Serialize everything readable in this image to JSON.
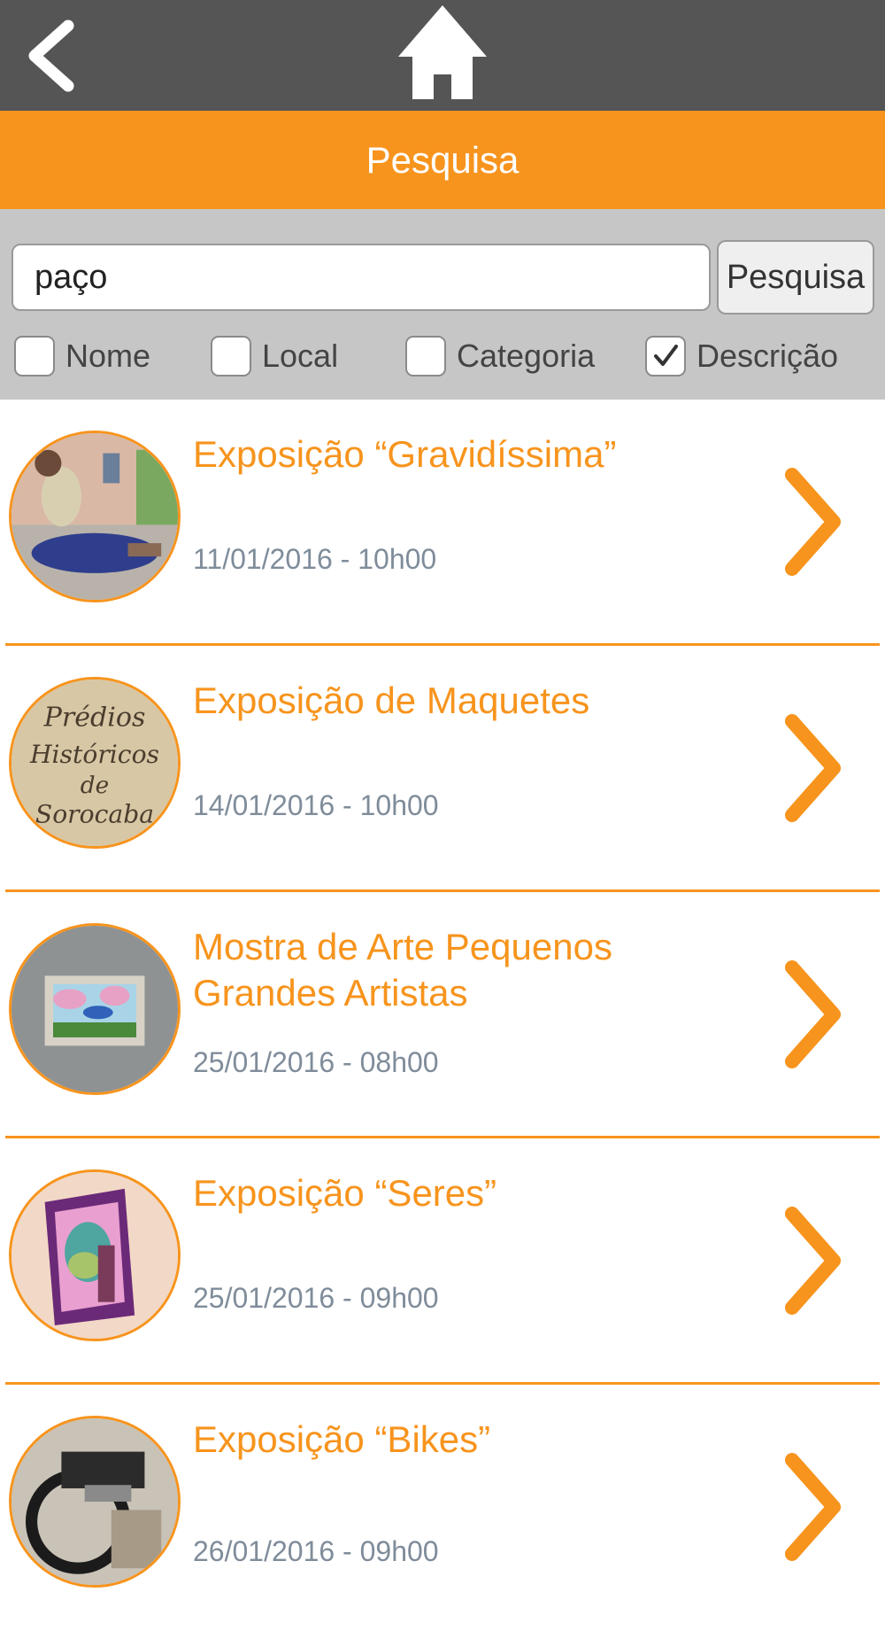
{
  "header": {
    "back_icon": "chevron-left-icon",
    "home_icon": "home-icon"
  },
  "title": "Pesquisa",
  "search": {
    "value": "paço",
    "button_label": "Pesquisa"
  },
  "filters": [
    {
      "label": "Nome",
      "checked": false
    },
    {
      "label": "Local",
      "checked": false
    },
    {
      "label": "Categoria",
      "checked": false
    },
    {
      "label": "Descrição",
      "checked": true
    }
  ],
  "colors": {
    "accent": "#F7941D",
    "header_bg": "#555555",
    "panel_bg": "#C6C6C6",
    "date_text": "#7F8C9A"
  },
  "results": [
    {
      "title": "Exposição “Gravidíssima”",
      "date": "11/01/2016 - 10h00"
    },
    {
      "title": "Exposição de Maquetes",
      "date": "14/01/2016 - 10h00"
    },
    {
      "title": "Mostra de Arte Pequenos Grandes Artistas",
      "date": "25/01/2016 - 08h00"
    },
    {
      "title": "Exposição “Seres”",
      "date": "25/01/2016 - 09h00"
    },
    {
      "title": "Exposição “Bikes”",
      "date": "26/01/2016 - 09h00"
    }
  ],
  "thumb2_text": [
    "Prédios",
    "Históricos",
    "de",
    "Sorocaba"
  ]
}
